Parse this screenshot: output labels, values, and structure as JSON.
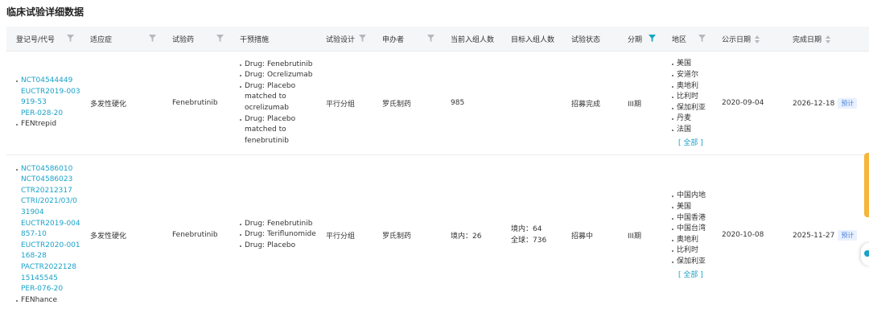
{
  "page": {
    "title": "临床试验详细数据"
  },
  "table": {
    "headers": {
      "reg_no": "登记号/代号",
      "indication": "适应症",
      "drug": "试验药",
      "intervention": "干预措施",
      "design": "试验设计",
      "sponsor": "申办者",
      "current_enroll": "当前入组人数",
      "target_enroll": "目标入组人数",
      "status": "试验状态",
      "phase": "分期",
      "region": "地区",
      "pub_date": "公示日期",
      "done_date": "完成日期"
    },
    "rows": [
      {
        "reg_ids": [
          "NCT04544449",
          "EUCTR2019-003919-53",
          "PER-028-20"
        ],
        "alias": "FENtrepid",
        "indication": "多发性硬化",
        "drug": "Fenebrutinib",
        "interventions": [
          "Drug: Fenebrutinib",
          "Drug: Ocrelizumab",
          "Drug: Placebo matched to ocrelizumab",
          "Drug: Placebo matched to fenebrutinib"
        ],
        "design": "平行分组",
        "sponsor": "罗氏制药",
        "current_enroll": "985",
        "target_enroll_line1": "",
        "target_enroll_line2": "",
        "status": "招募完成",
        "phase": "III期",
        "regions": [
          "美国",
          "安道尔",
          "奥地利",
          "比利时",
          "保加利亚",
          "丹麦",
          "法国"
        ],
        "regions_all": "[ 全部 ]",
        "pub_date": "2020-09-04",
        "done_date": "2026-12-18",
        "done_badge": "预计"
      },
      {
        "reg_ids": [
          "NCT04586010",
          "NCT04586023",
          "CTR20212317",
          "CTRI/2021/03/031904",
          "EUCTR2019-004857-10",
          "EUCTR2020-001168-28",
          "PACTR202212815145545",
          "PER-076-20"
        ],
        "alias": "FENhance",
        "indication": "多发性硬化",
        "drug": "Fenebrutinib",
        "interventions": [
          "Drug: Fenebrutinib",
          "Drug: Teriflunomide",
          "Drug: Placebo"
        ],
        "design": "平行分组",
        "sponsor": "罗氏制药",
        "current_enroll": "境内：26",
        "target_enroll_line1": "境内：64",
        "target_enroll_line2": "全球：736",
        "status": "招募中",
        "phase": "III期",
        "regions": [
          "中国内地",
          "美国",
          "中国香港",
          "中国台湾",
          "奥地利",
          "比利时",
          "保加利亚"
        ],
        "regions_all": "[ 全部 ]",
        "pub_date": "2020-10-08",
        "done_date": "2025-11-27",
        "done_badge": "预计"
      }
    ]
  },
  "colors": {
    "link": "#1aa2c8",
    "filter_active": "#12a4c4",
    "badge_bg": "#e9f1ff",
    "badge_text": "#4a7fd8"
  },
  "icons": {
    "filter": "filter-icon",
    "sort": "sort-icon"
  }
}
